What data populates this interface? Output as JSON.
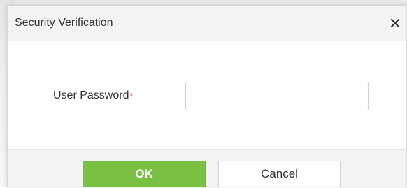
{
  "dialog": {
    "title": "Security Verification",
    "close_icon": "close-icon",
    "close_glyph": "×"
  },
  "form": {
    "password_label": "User Password",
    "required_marker": "*",
    "password_value": "",
    "password_placeholder": ""
  },
  "footer": {
    "ok_label": "OK",
    "cancel_label": "Cancel"
  },
  "colors": {
    "ok_button": "#7ac143",
    "required_marker": "#e02020",
    "header_bg": "#f3f3f3"
  }
}
